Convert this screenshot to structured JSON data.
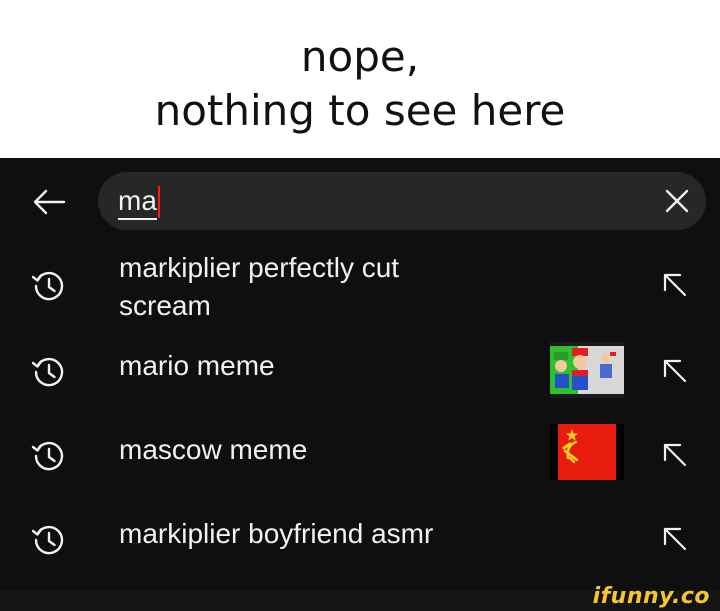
{
  "caption": {
    "line1": "nope,",
    "line2": "nothing to see here"
  },
  "search": {
    "query": "ma",
    "back_icon": "arrow-left-icon",
    "clear_icon": "close-icon"
  },
  "suggestions": [
    {
      "line1": "markiplier perfectly cut",
      "line2": "scream",
      "icon": "history-icon",
      "action_icon": "arrow-up-left-icon"
    },
    {
      "line1": "mario meme",
      "icon": "history-icon",
      "action_icon": "arrow-up-left-icon",
      "thumbnail": "mario-luigi-thumbnail"
    },
    {
      "line1": "mascow meme",
      "icon": "history-icon",
      "action_icon": "arrow-up-left-icon",
      "thumbnail": "soviet-flag-thumbnail"
    },
    {
      "line1": "markiplier boyfriend asmr",
      "icon": "history-icon",
      "action_icon": "arrow-up-left-icon"
    }
  ],
  "watermark": "ifunny.co",
  "colors": {
    "app_background": "#0f0f0f",
    "search_box": "#272727",
    "text": "#f1f1f1",
    "caret": "#ff1a1a",
    "flag_red": "#e81b0f",
    "flag_gold": "#f6d21c",
    "watermark": "#f6c533"
  }
}
